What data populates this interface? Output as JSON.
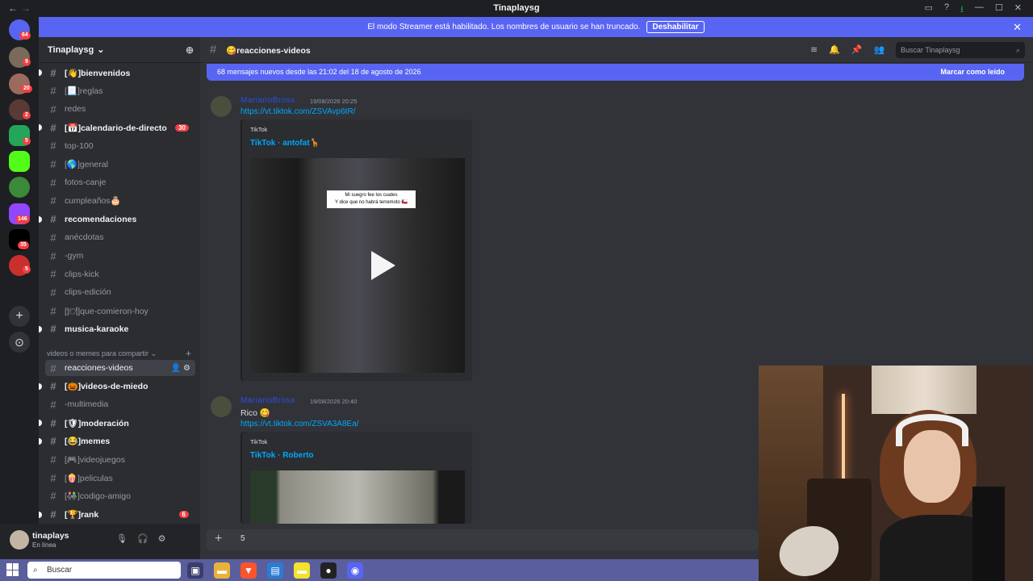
{
  "window": {
    "title": "Tinaplaysg",
    "back": "←",
    "forward": "→",
    "icons": [
      "▭",
      "?",
      "⭳",
      "—",
      "☐",
      "✕"
    ]
  },
  "banner": {
    "text": "El modo Streamer está habilitado. Los nombres de usuario se han truncado.",
    "button": "Deshabilitar",
    "close": "✕"
  },
  "guilds": {
    "badges": [
      "64",
      "9",
      "20",
      "2",
      "5",
      "146",
      "35",
      "5"
    ],
    "add": "+",
    "explore": "⊙"
  },
  "server": {
    "name": "Tinaplaysg",
    "chevron": "⌄",
    "add_icon": "⊕"
  },
  "channels": [
    {
      "name": "[👋]bienvenidos",
      "unread": true
    },
    {
      "name": "[📃]reglas",
      "unread": false
    },
    {
      "name": "redes",
      "unread": false
    },
    {
      "name": "[📅]calendario-de-directo",
      "unread": true,
      "badge": "30"
    },
    {
      "name": "top-100",
      "unread": false
    },
    {
      "name": "[🌎]general",
      "unread": false
    },
    {
      "name": "fotos-canje",
      "unread": false
    },
    {
      "name": "cumpleaños🎂",
      "unread": false
    },
    {
      "name": "recomendaciones",
      "unread": true
    },
    {
      "name": "anécdotas",
      "unread": false
    },
    {
      "name": "-gym",
      "unread": false
    },
    {
      "name": "clips-kick",
      "unread": false
    },
    {
      "name": "clips-edición",
      "unread": false
    },
    {
      "name": "[🍽]que-comieron-hoy",
      "unread": false
    },
    {
      "name": "musica-karaoke",
      "unread": true
    }
  ],
  "category": {
    "name": "videos o memes para compartir",
    "plus": "+"
  },
  "channels2": [
    {
      "name": "reacciones-videos",
      "active": true
    },
    {
      "name": "[🎃]videos-de-miedo",
      "unread": true
    },
    {
      "name": "-multimedia",
      "unread": false
    },
    {
      "name": "[🛡]moderación",
      "unread": true
    },
    {
      "name": "[😂]memes",
      "unread": true
    },
    {
      "name": "[🎮]videojuegos",
      "unread": false
    },
    {
      "name": "[🍿]peliculas",
      "unread": false
    },
    {
      "name": "[👫]codigo-amigo",
      "unread": false
    },
    {
      "name": "[🏆]rank",
      "unread": true,
      "badge": "6"
    }
  ],
  "user": {
    "name": "tinaplays",
    "status": "En línea",
    "icons": [
      "🎙",
      "🎧",
      "⚙"
    ]
  },
  "header": {
    "channel": "😋reacciones-videos",
    "search_placeholder": "Buscar Tinaplaysg",
    "icons": [
      "≋",
      "🔔",
      "📌",
      "👥"
    ],
    "search_icon": "⌕"
  },
  "newbar": {
    "text": "68 mensajes nuevos desde las 21:02 del 18 de agosto de 2026",
    "mark": "Marcar como leído"
  },
  "messages": [
    {
      "author": "MarianoBrosx",
      "time": "19/08/2026 20:25",
      "text": "",
      "link": "https://vt.tiktok.com/ZSVAvp6tR/",
      "provider": "TikTok",
      "embed_title": "TikTok · antofat🦒",
      "caption": "Mi suegro fee los cuates\nY dice que no habrá terremoto 🇨🇱"
    },
    {
      "author": "MarianoBrosx",
      "time": "19/08/2026 20:40",
      "text": "Rico 😋",
      "link": "https://vt.tiktok.com/ZSVA3A8Ea/",
      "provider": "TikTok",
      "embed_title": "TikTok · Roberto"
    }
  ],
  "composer": {
    "value": "5",
    "plus": "+"
  },
  "taskbar": {
    "search": "Buscar",
    "search_icon": "⌕"
  }
}
